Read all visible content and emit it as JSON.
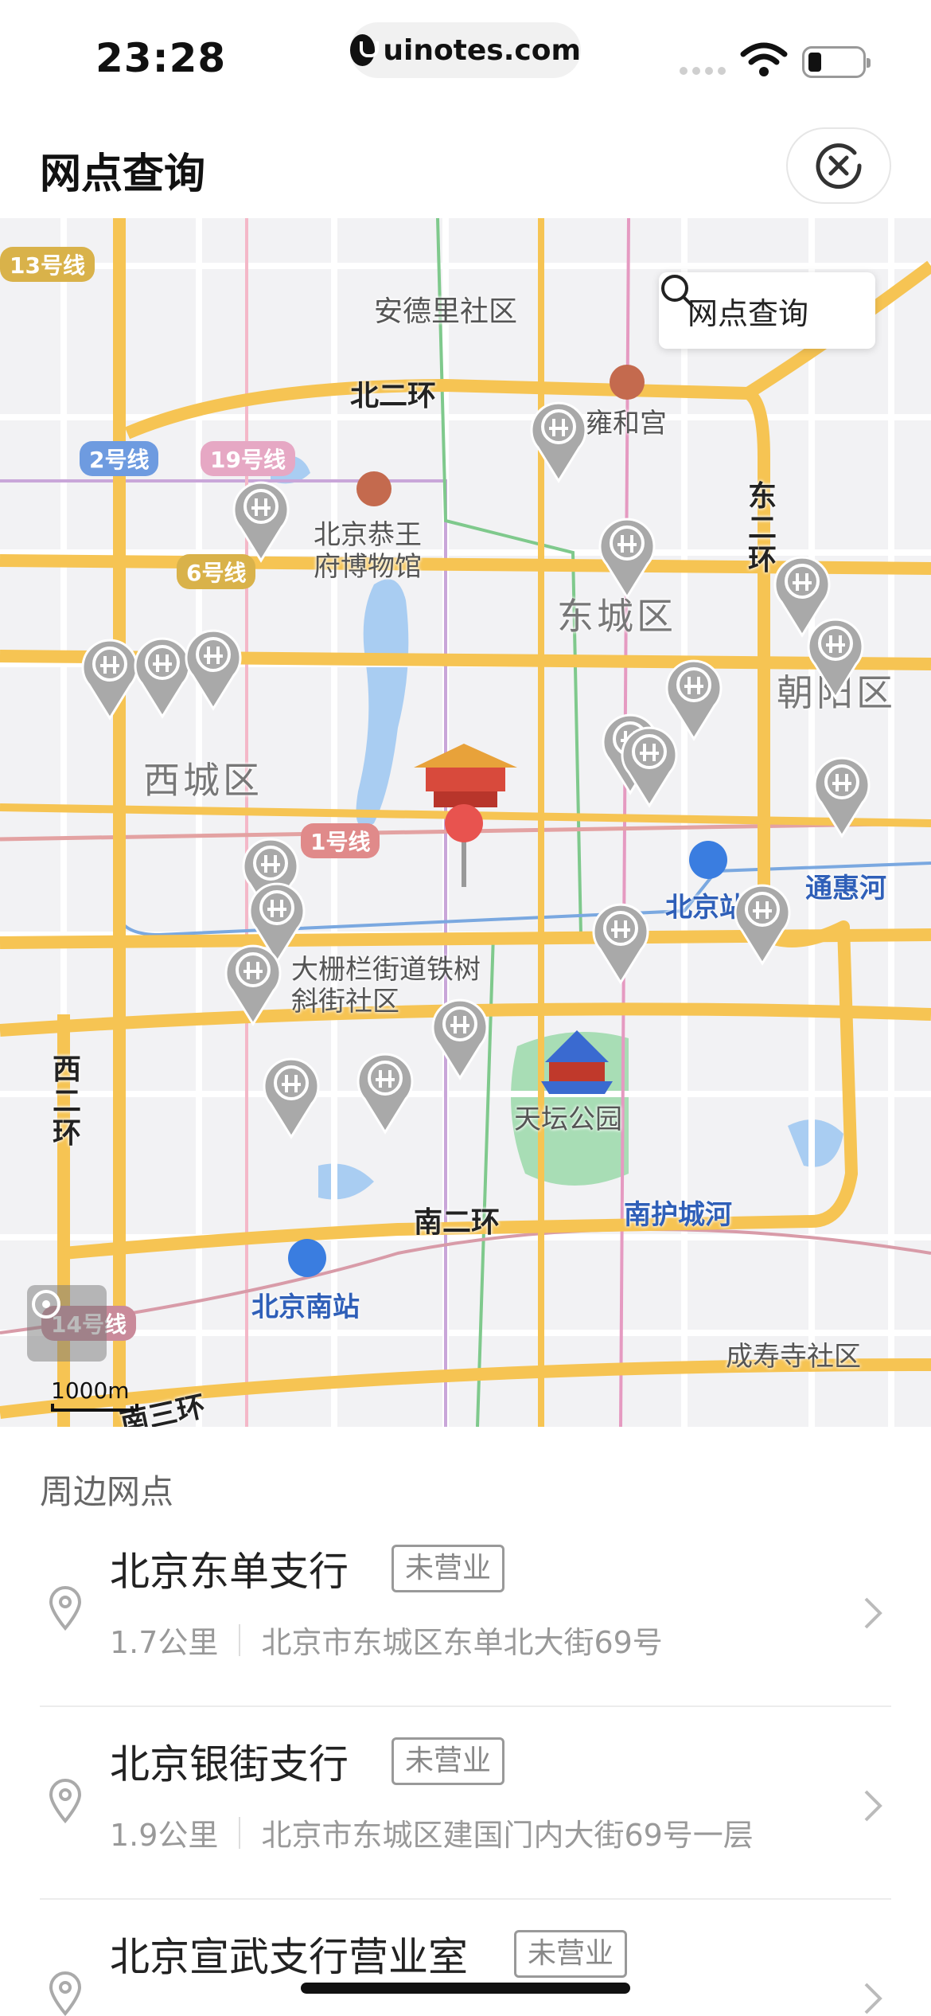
{
  "status_bar": {
    "time": "23:28",
    "url": "uinotes.com"
  },
  "header": {
    "title": "网点查询",
    "close_icon": "close-circle-icon"
  },
  "map": {
    "search_button_label": "网点查询",
    "labels": {
      "line13": "13号线",
      "line2": "2号线",
      "line19": "19号线",
      "line6": "6号线",
      "line1": "1号线",
      "line14": "14号线",
      "anderli": "安德里社区",
      "beierhuan": "北二环",
      "yonghegong": "雍和宫",
      "dongerhuan": "东二环",
      "gongwangfu": "北京恭王府博物馆",
      "dongcheng": "东城区",
      "chaoyang": "朝阳区",
      "xicheng": "西城区",
      "beijingzhan": "北京站",
      "tonghuihe": "通惠河",
      "dashilan": "大栅栏街道铁树斜街社区",
      "tiantan": "天坛公园",
      "xierhuan": "西二环",
      "nanerhuan": "南二环",
      "nanhuchenghe": "南护城河",
      "beijingnanzhan": "北京南站",
      "chengshousi": "成寿寺社区",
      "nansanhuan": "南三环"
    },
    "scale_label": "1000m",
    "colors": {
      "road_major": "#f6c453",
      "road_minor": "#ffffff",
      "water": "#a9cdf2",
      "park": "#a8ddb5",
      "pin": "#a9a9a9",
      "center_marker": "#e8534f"
    }
  },
  "list": {
    "title": "周边网点",
    "items": [
      {
        "name": "北京东单支行",
        "status": "未营业",
        "distance": "1.7公里",
        "address": "北京市东城区东单北大街69号"
      },
      {
        "name": "北京银街支行",
        "status": "未营业",
        "distance": "1.9公里",
        "address": "北京市东城区建国门内大街69号一层"
      },
      {
        "name": "北京宣武支行营业室",
        "status": "未营业",
        "distance": "",
        "address": ""
      }
    ]
  }
}
